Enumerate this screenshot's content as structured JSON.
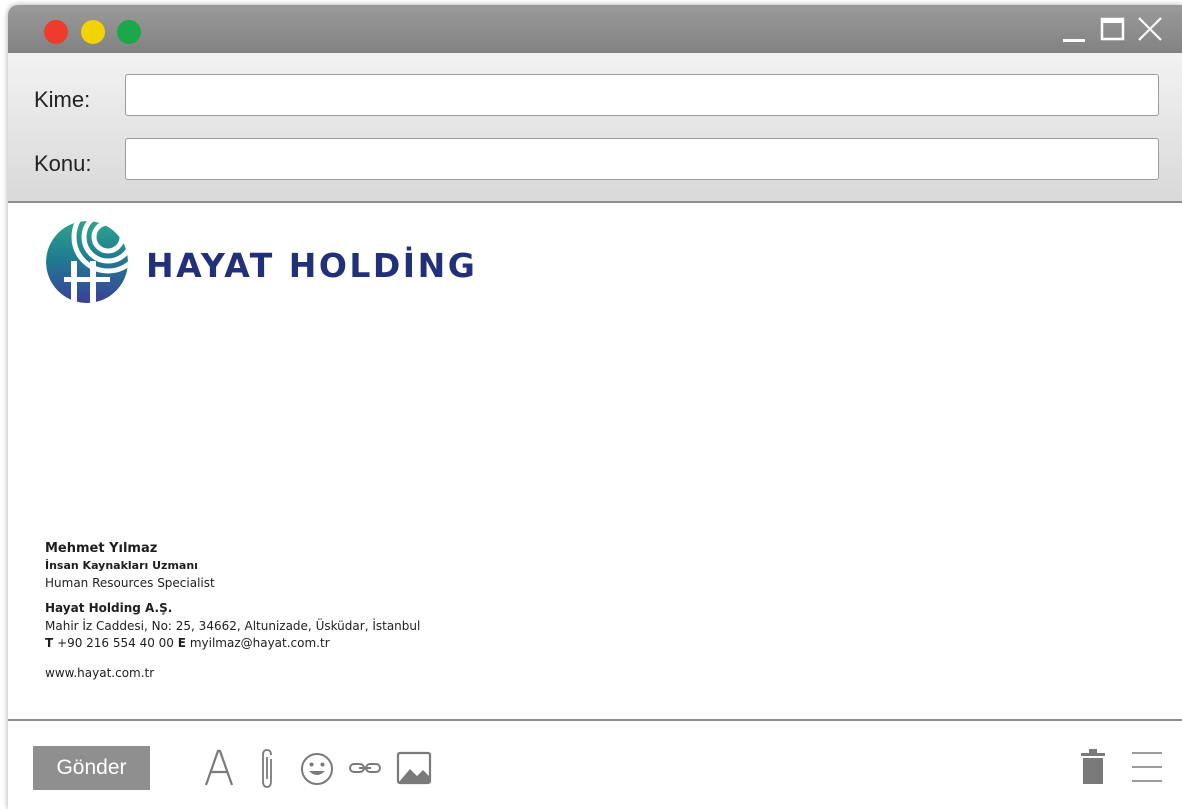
{
  "window": {
    "controls": {
      "close_color": "#ee3b2b",
      "minimize_color": "#f2d300",
      "zoom_color": "#1aa84a"
    }
  },
  "compose": {
    "to_label": "Kime:",
    "to_value": "",
    "subject_label": "Konu:",
    "subject_value": ""
  },
  "signature": {
    "logo_text": "HAYAT HOLDİNG",
    "name": "Mehmet Yılmaz",
    "title_tr": "İnsan Kaynakları Uzmanı",
    "title_en": "Human Resources Specialist",
    "company": "Hayat Holding A.Ş.",
    "address": "Mahir İz Caddesi, No: 25, 34662, Altunizade, Üsküdar, İstanbul",
    "phone_label": "T",
    "phone": "+90 216 554 40 00",
    "email_label": "E",
    "email": "myilmaz@hayat.com.tr",
    "website": "www.hayat.com.tr",
    "brand_color": "#22307a"
  },
  "toolbar": {
    "send_label": "Gönder",
    "icons": [
      "font-icon",
      "attachment-icon",
      "emoji-icon",
      "link-icon",
      "image-icon",
      "trash-icon",
      "menu-icon"
    ]
  }
}
